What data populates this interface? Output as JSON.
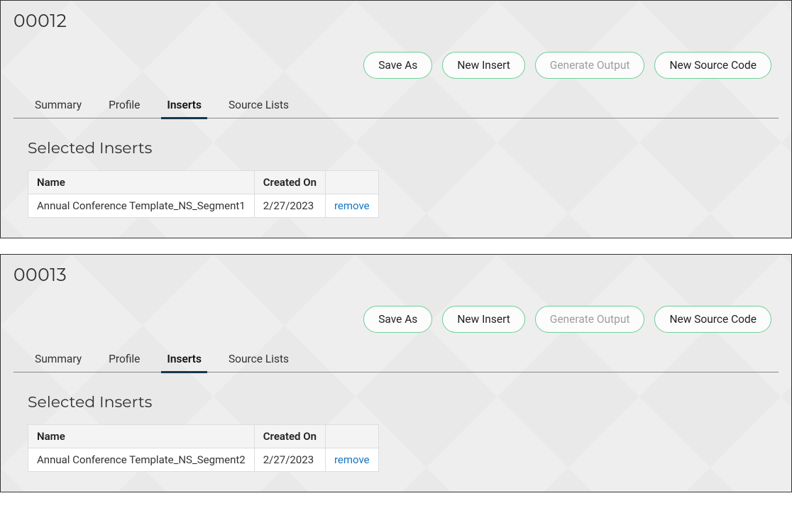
{
  "buttons": {
    "save_as": "Save As",
    "new_insert": "New Insert",
    "generate_output": "Generate Output",
    "new_source_code": "New Source Code"
  },
  "tabs": {
    "summary": "Summary",
    "profile": "Profile",
    "inserts": "Inserts",
    "source_lists": "Source Lists"
  },
  "section": {
    "selected_inserts": "Selected Inserts"
  },
  "table_headers": {
    "name": "Name",
    "created_on": "Created On"
  },
  "actions": {
    "remove": "remove"
  },
  "panels": [
    {
      "title": "00012",
      "rows": [
        {
          "name": "Annual Conference Template_NS_Segment1",
          "created_on": "2/27/2023"
        }
      ]
    },
    {
      "title": "00013",
      "rows": [
        {
          "name": "Annual Conference Template_NS_Segment2",
          "created_on": "2/27/2023"
        }
      ]
    }
  ]
}
